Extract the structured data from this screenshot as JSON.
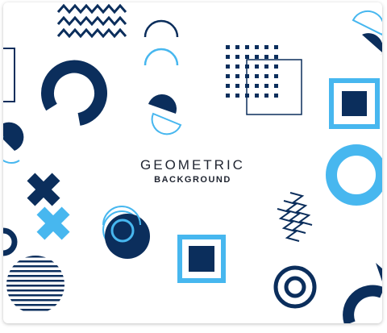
{
  "heading": {
    "title": "GEOMETRIC",
    "subtitle": "BACKGROUND"
  },
  "colors": {
    "navy": "#0b2e5c",
    "sky": "#47b7ef",
    "outline": "#0b2e5c"
  },
  "shapes": [
    "zigzag-lines",
    "arch-pair",
    "dot-grid",
    "half-circle-pair",
    "arc-ring",
    "square-frame-outline",
    "square-in-square",
    "ring-large",
    "half-circles-left",
    "cross-pair",
    "concentric-circles",
    "square-in-square-bottom",
    "zigzag-diagonal",
    "striped-circle",
    "target-rings",
    "arc-bottom-right"
  ]
}
